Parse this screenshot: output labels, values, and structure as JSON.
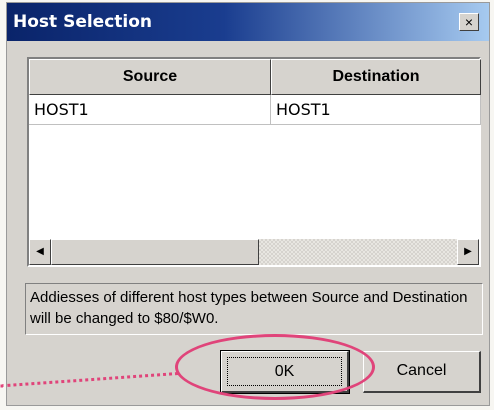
{
  "window": {
    "title": "Host Selection",
    "close_label": "×"
  },
  "table": {
    "columns": [
      "Source",
      "Destination"
    ],
    "rows": [
      {
        "source": "HOST1",
        "destination": "HOST1"
      }
    ],
    "scroll_left_glyph": "◀",
    "scroll_right_glyph": "▶"
  },
  "info": {
    "text": "Addiesses of different host types between Source and Destination will be changed to $80/$W0."
  },
  "buttons": {
    "ok_label": "0K",
    "cancel_label": "Cancel"
  },
  "annotation": {
    "highlight_color": "#e0447a"
  },
  "colors": {
    "titlebar_start": "#0a246a",
    "titlebar_end": "#a6caf0",
    "dialog_face": "#d6d3ce"
  }
}
